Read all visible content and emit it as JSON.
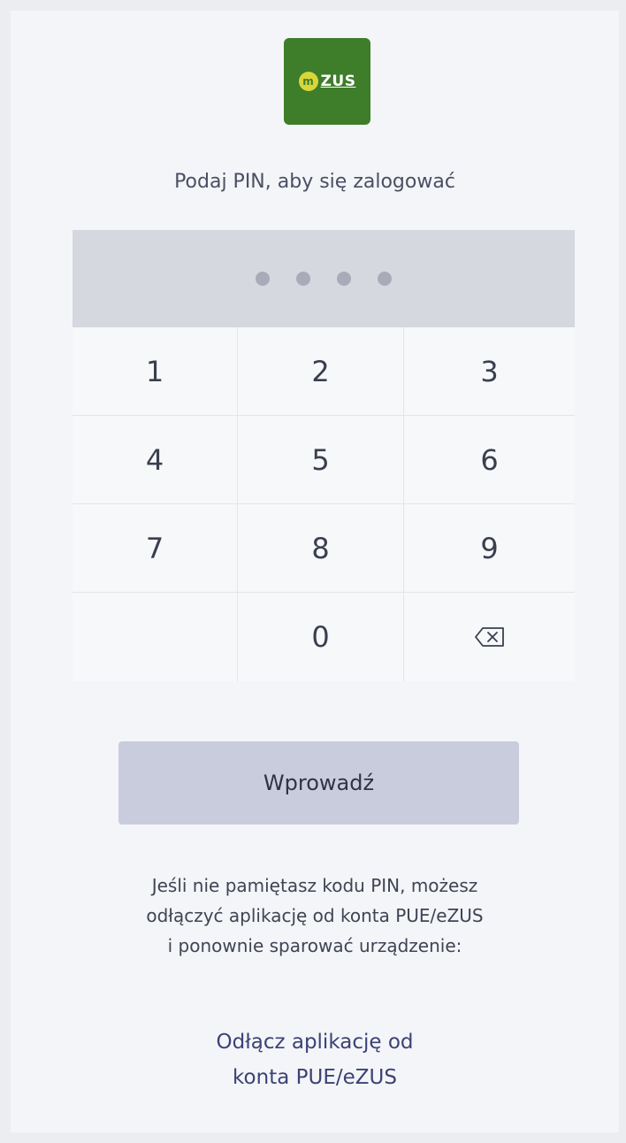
{
  "logo": {
    "text": "ZUS",
    "m_letter": "m"
  },
  "prompt": "Podaj PIN, aby się zalogować",
  "pin": {
    "entered_digits": 4
  },
  "keypad": {
    "keys": [
      "1",
      "2",
      "3",
      "4",
      "5",
      "6",
      "7",
      "8",
      "9",
      "",
      "0",
      ""
    ],
    "backspace_icon": "backspace-icon"
  },
  "submit_label": "Wprowadź",
  "help_lines": [
    "Jeśli nie pamiętasz kodu PIN, możesz",
    "odłączyć aplikację od konta PUE/eZUS",
    "i ponownie sparować urządzenie:"
  ],
  "unlink_lines": [
    "Odłącz aplikację od",
    "konta PUE/eZUS"
  ]
}
